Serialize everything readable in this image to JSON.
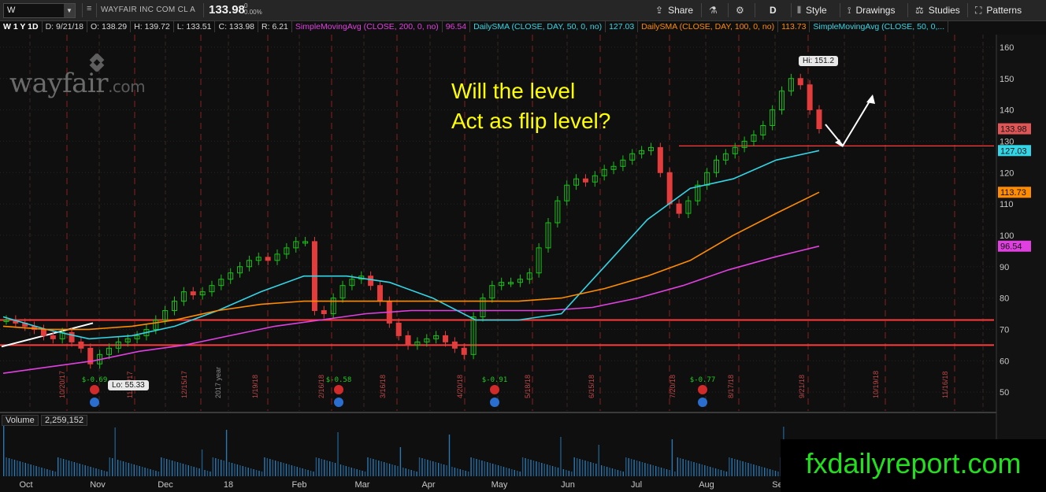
{
  "toolbar": {
    "symbol": "W",
    "company": "WAYFAIR INC COM CL A",
    "last": "133.98",
    "change": "0",
    "change_pct": "0.00%",
    "share": "Share",
    "timeframe": "D",
    "style": "Style",
    "drawings": "Drawings",
    "studies": "Studies",
    "patterns": "Patterns"
  },
  "infobar": {
    "period": "W 1 Y 1D",
    "date": "D: 9/21/18",
    "open": "O: 138.29",
    "high": "H: 139.72",
    "low": "L: 133.51",
    "close": "C: 133.98",
    "range": "R: 6.21",
    "sma200_label": "SimpleMovingAvg (CLOSE, 200, 0, no)",
    "sma200_value": "96.54",
    "sma50_label": "DailySMA (CLOSE, DAY, 50, 0, no)",
    "sma50_value": "127.03",
    "sma100_label": "DailySMA (CLOSE, DAY, 100, 0, no)",
    "sma100_value": "113.73",
    "sma50b_label": "SimpleMovingAvg (CLOSE, 50, 0,..."
  },
  "volume": {
    "label": "Volume",
    "value": "2,259,152"
  },
  "annotation": {
    "line1": "Will the level",
    "line2": "Act as flip level?"
  },
  "watermark": "fxdailyreport.com",
  "logo": {
    "main": "wayfair",
    "suffix": ".com"
  },
  "colors": {
    "up": "#19c219",
    "down": "#e23c3c",
    "sma50": "#33d6e6",
    "sma100": "#ff8c00",
    "sma200": "#e040e0",
    "level": "#ff3b3b",
    "annotation": "#ffff00"
  },
  "chart_data": {
    "type": "candlestick",
    "x_ticks": [
      "Oct",
      "Nov",
      "Dec",
      "18",
      "Feb",
      "Mar",
      "Apr",
      "May",
      "Jun",
      "Jul",
      "Aug",
      "Se"
    ],
    "y_ticks": [
      50,
      60,
      70,
      80,
      90,
      100,
      110,
      120,
      130,
      140,
      150,
      160
    ],
    "ylim": [
      44,
      164
    ],
    "price_tags": [
      {
        "label": "133.98",
        "value": 133.98,
        "color": "#e05656"
      },
      {
        "label": "127.03",
        "value": 127.03,
        "color": "#33d6e6"
      },
      {
        "label": "113.73",
        "value": 113.73,
        "color": "#ff8c00"
      },
      {
        "label": "96.54",
        "value": 96.54,
        "color": "#e040e0"
      }
    ],
    "high_label": "Hi: 151.2",
    "low_label": "Lo: 55.33",
    "horizontal_levels": [
      128.5,
      73,
      65
    ],
    "close_series": [
      73,
      72,
      71,
      70,
      68,
      67,
      69,
      66,
      64,
      59,
      62,
      64,
      66,
      67,
      68,
      70,
      73,
      76,
      79,
      82,
      81,
      82,
      84,
      86,
      88,
      90,
      92,
      93,
      92,
      94,
      96,
      98,
      98,
      76,
      75,
      80,
      84,
      86,
      87,
      84,
      79,
      72,
      68,
      65,
      66,
      67,
      68,
      66,
      64,
      62,
      74,
      80,
      84,
      85,
      85,
      86,
      88,
      96,
      104,
      111,
      116,
      118,
      117,
      119,
      121,
      122,
      124,
      126,
      127,
      128,
      120,
      110,
      107,
      111,
      116,
      120,
      124,
      126,
      128,
      130,
      132,
      135,
      140,
      146,
      150,
      148,
      140,
      134
    ],
    "series": [
      {
        "name": "SimpleMovingAvg (CLOSE, 200, 0, no)",
        "values": [
          56,
          58,
          60,
          63,
          65,
          68,
          71,
          73,
          75,
          76,
          76,
          76,
          76,
          77,
          80,
          84,
          89,
          93,
          96.54
        ]
      },
      {
        "name": "DailySMA (CLOSE, DAY, 50, 0, no)",
        "values": [
          74,
          70,
          67,
          68,
          71,
          76,
          82,
          87,
          87,
          85,
          80,
          73,
          73,
          75,
          90,
          105,
          115,
          118,
          124,
          127.03
        ]
      },
      {
        "name": "DailySMA (CLOSE, DAY, 100, 0, no)",
        "values": [
          71,
          70,
          70,
          71,
          73,
          76,
          78,
          79,
          79,
          79,
          79,
          79,
          79,
          80,
          83,
          87,
          92,
          100,
          107,
          113.73
        ]
      }
    ],
    "dividends": [
      "$-0.69",
      "$-0.58",
      "$-0.91",
      "$-0.77"
    ],
    "date_labels": [
      "10/20/17",
      "11/17/17",
      "12/15/17",
      "2017 year",
      "1/19/18",
      "2/16/18",
      "3/16/18",
      "4/20/18",
      "5/18/18",
      "6/15/18",
      "7/20/18",
      "8/17/18",
      "9/21/18",
      "10/19/18",
      "11/16/18"
    ],
    "volume_label": "Volume 2,259,152"
  }
}
